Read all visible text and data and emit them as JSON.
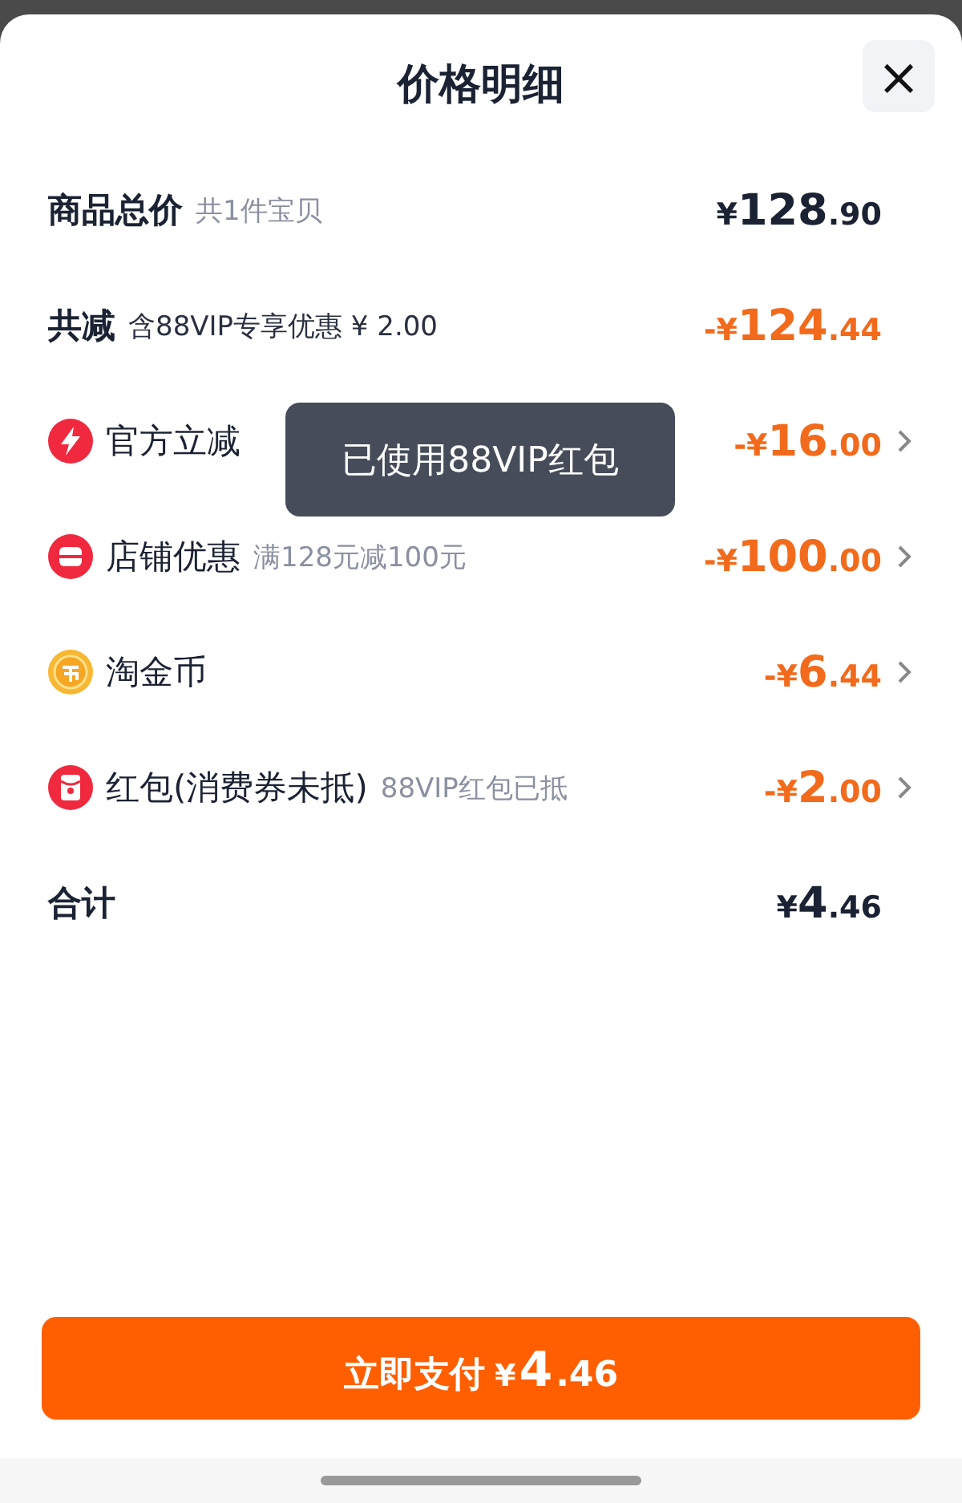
{
  "sheet": {
    "title": "价格明细",
    "close_label": "×"
  },
  "rows": [
    {
      "kind": "summary",
      "label": "商品总价",
      "note": "共1件宝贝",
      "amount": {
        "color": "#1b2233",
        "prefix": "¥",
        "integer": "128",
        "decimal": ".90"
      }
    },
    {
      "kind": "summary",
      "label": "共减",
      "note": "含88VIP专享优惠 ¥ 2.00",
      "amount": {
        "color": "#f26a1b",
        "prefix": "-¥",
        "integer": "124",
        "decimal": ".44"
      }
    },
    {
      "kind": "discount",
      "label": "官方立减",
      "amount": {
        "color": "#f26a1b",
        "prefix": "-¥",
        "integer": "16",
        "decimal": ".00"
      }
    },
    {
      "kind": "discount",
      "label": "店铺优惠",
      "note": "满128元减100元",
      "amount": {
        "color": "#f26a1b",
        "prefix": "-¥",
        "integer": "100",
        "decimal": ".00"
      }
    },
    {
      "kind": "discount",
      "label": "淘金币",
      "amount": {
        "color": "#f26a1b",
        "prefix": "-¥",
        "integer": "6",
        "decimal": ".44"
      }
    },
    {
      "kind": "discount",
      "label": "红包(消费券未抵)",
      "note": "88VIP红包已抵",
      "amount": {
        "color": "#f26a1b",
        "prefix": "-¥",
        "integer": "2",
        "decimal": ".00"
      }
    },
    {
      "kind": "summary",
      "label": "合计",
      "amount": {
        "color": "#1b2233",
        "prefix": "¥",
        "integer": "4",
        "decimal": ".46"
      }
    }
  ],
  "tooltip": {
    "text": "已使用88VIP红包"
  },
  "pay_button": {
    "label": "立即支付",
    "amount": {
      "prefix": "¥",
      "integer": "4",
      "decimal": ".46"
    }
  }
}
